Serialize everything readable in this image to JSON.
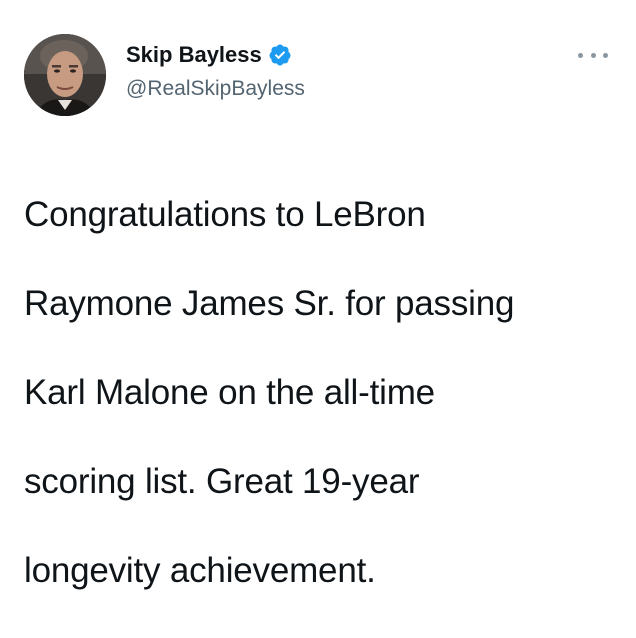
{
  "tweet": {
    "author": {
      "display_name": "Skip Bayless",
      "handle": "@RealSkipBayless",
      "verified": true,
      "avatar_icon": "profile-photo",
      "verified_color": "#1d9bf0"
    },
    "more_icon": "more-dots-icon",
    "text_lines": [
      "Congratulations to LeBron",
      "Raymone James Sr. for passing",
      "Karl Malone on the all-time",
      "scoring list. Great 19-year",
      "longevity achievement."
    ]
  }
}
